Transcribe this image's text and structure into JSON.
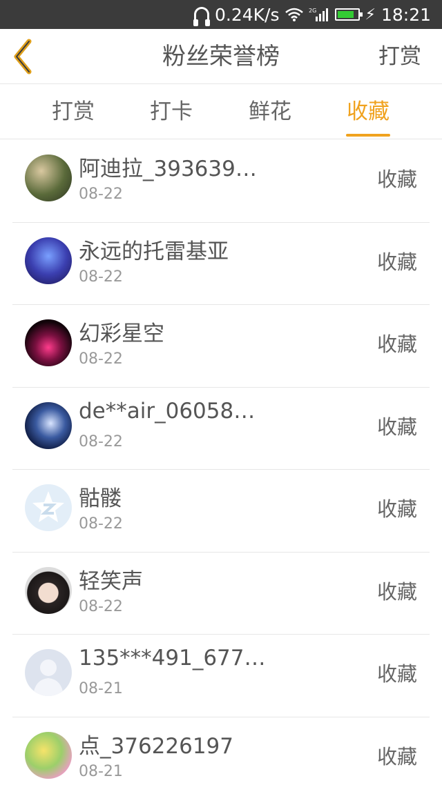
{
  "status_bar": {
    "net_speed": "0.24K/s",
    "time": "18:21",
    "network_type": "2G",
    "icons": [
      "headphone-icon",
      "wifi-icon",
      "signal-icon",
      "battery-icon",
      "charging-icon"
    ],
    "battery_level": 0.85,
    "battery_color": "#33cc33"
  },
  "header": {
    "title": "粉丝荣誉榜",
    "action_label": "打赏",
    "back_icon": "chevron-left-icon",
    "accent_color": "#f0a21e"
  },
  "tabs": [
    {
      "label": "打赏",
      "active": false
    },
    {
      "label": "打卡",
      "active": false
    },
    {
      "label": "鲜花",
      "active": false
    },
    {
      "label": "收藏",
      "active": true
    }
  ],
  "list": [
    {
      "name": "阿迪拉_393639…",
      "date": "08-22",
      "action": "收藏"
    },
    {
      "name": "永远的托雷基亚",
      "date": "08-22",
      "action": "收藏"
    },
    {
      "name": "幻彩星空",
      "date": "08-22",
      "action": "收藏"
    },
    {
      "name": "de**air_06058…",
      "date": "08-22",
      "action": "收藏"
    },
    {
      "name": "骷髅",
      "date": "08-22",
      "action": "收藏"
    },
    {
      "name": "轻笑声",
      "date": "08-22",
      "action": "收藏"
    },
    {
      "name": "135***491_677…",
      "date": "08-21",
      "action": "收藏"
    },
    {
      "name": "点_376226197",
      "date": "08-21",
      "action": "收藏"
    }
  ]
}
